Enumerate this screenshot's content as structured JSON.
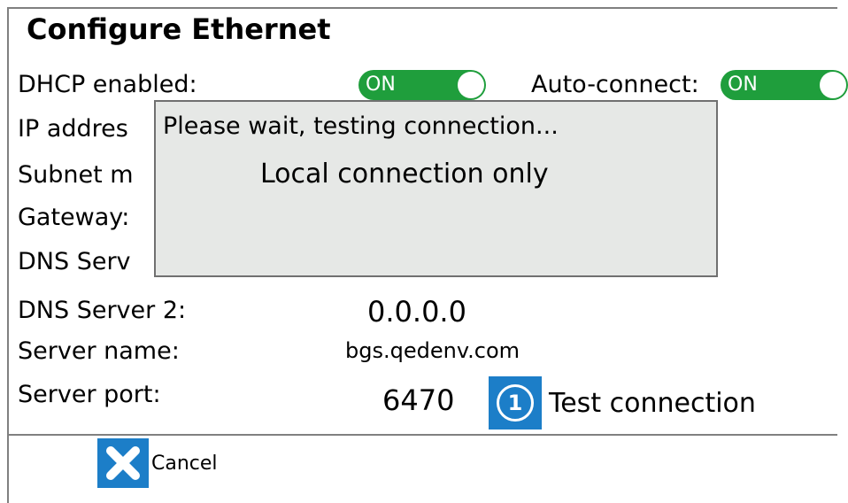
{
  "title": "Configure Ethernet",
  "fields": {
    "dhcp_label": "DHCP enabled:",
    "dhcp_toggle": "ON",
    "autoconnect_label": "Auto-connect:",
    "autoconnect_toggle": "ON",
    "ip_label": "IP addres",
    "subnet_label": "Subnet m",
    "gateway_label": "Gateway:",
    "dns1_label": "DNS Serv",
    "dns2_label": "DNS Server 2:",
    "dns2_value": "0.0.0.0",
    "server_name_label": "Server name:",
    "server_name_value": "bgs.qedenv.com",
    "server_port_label": "Server port:",
    "server_port_value": "6470"
  },
  "test_button": {
    "icon_text": "1",
    "label": "Test connection"
  },
  "dialog": {
    "message": "Please wait, testing connection...",
    "result": "Local connection only"
  },
  "cancel_button": {
    "label": "Cancel"
  },
  "colors": {
    "toggle_on": "#1f9e3c",
    "button_blue": "#1c7ec8",
    "dialog_bg": "#e6e8e6"
  },
  "icons": {
    "test": "info-circle-icon",
    "cancel": "close-x-icon"
  }
}
